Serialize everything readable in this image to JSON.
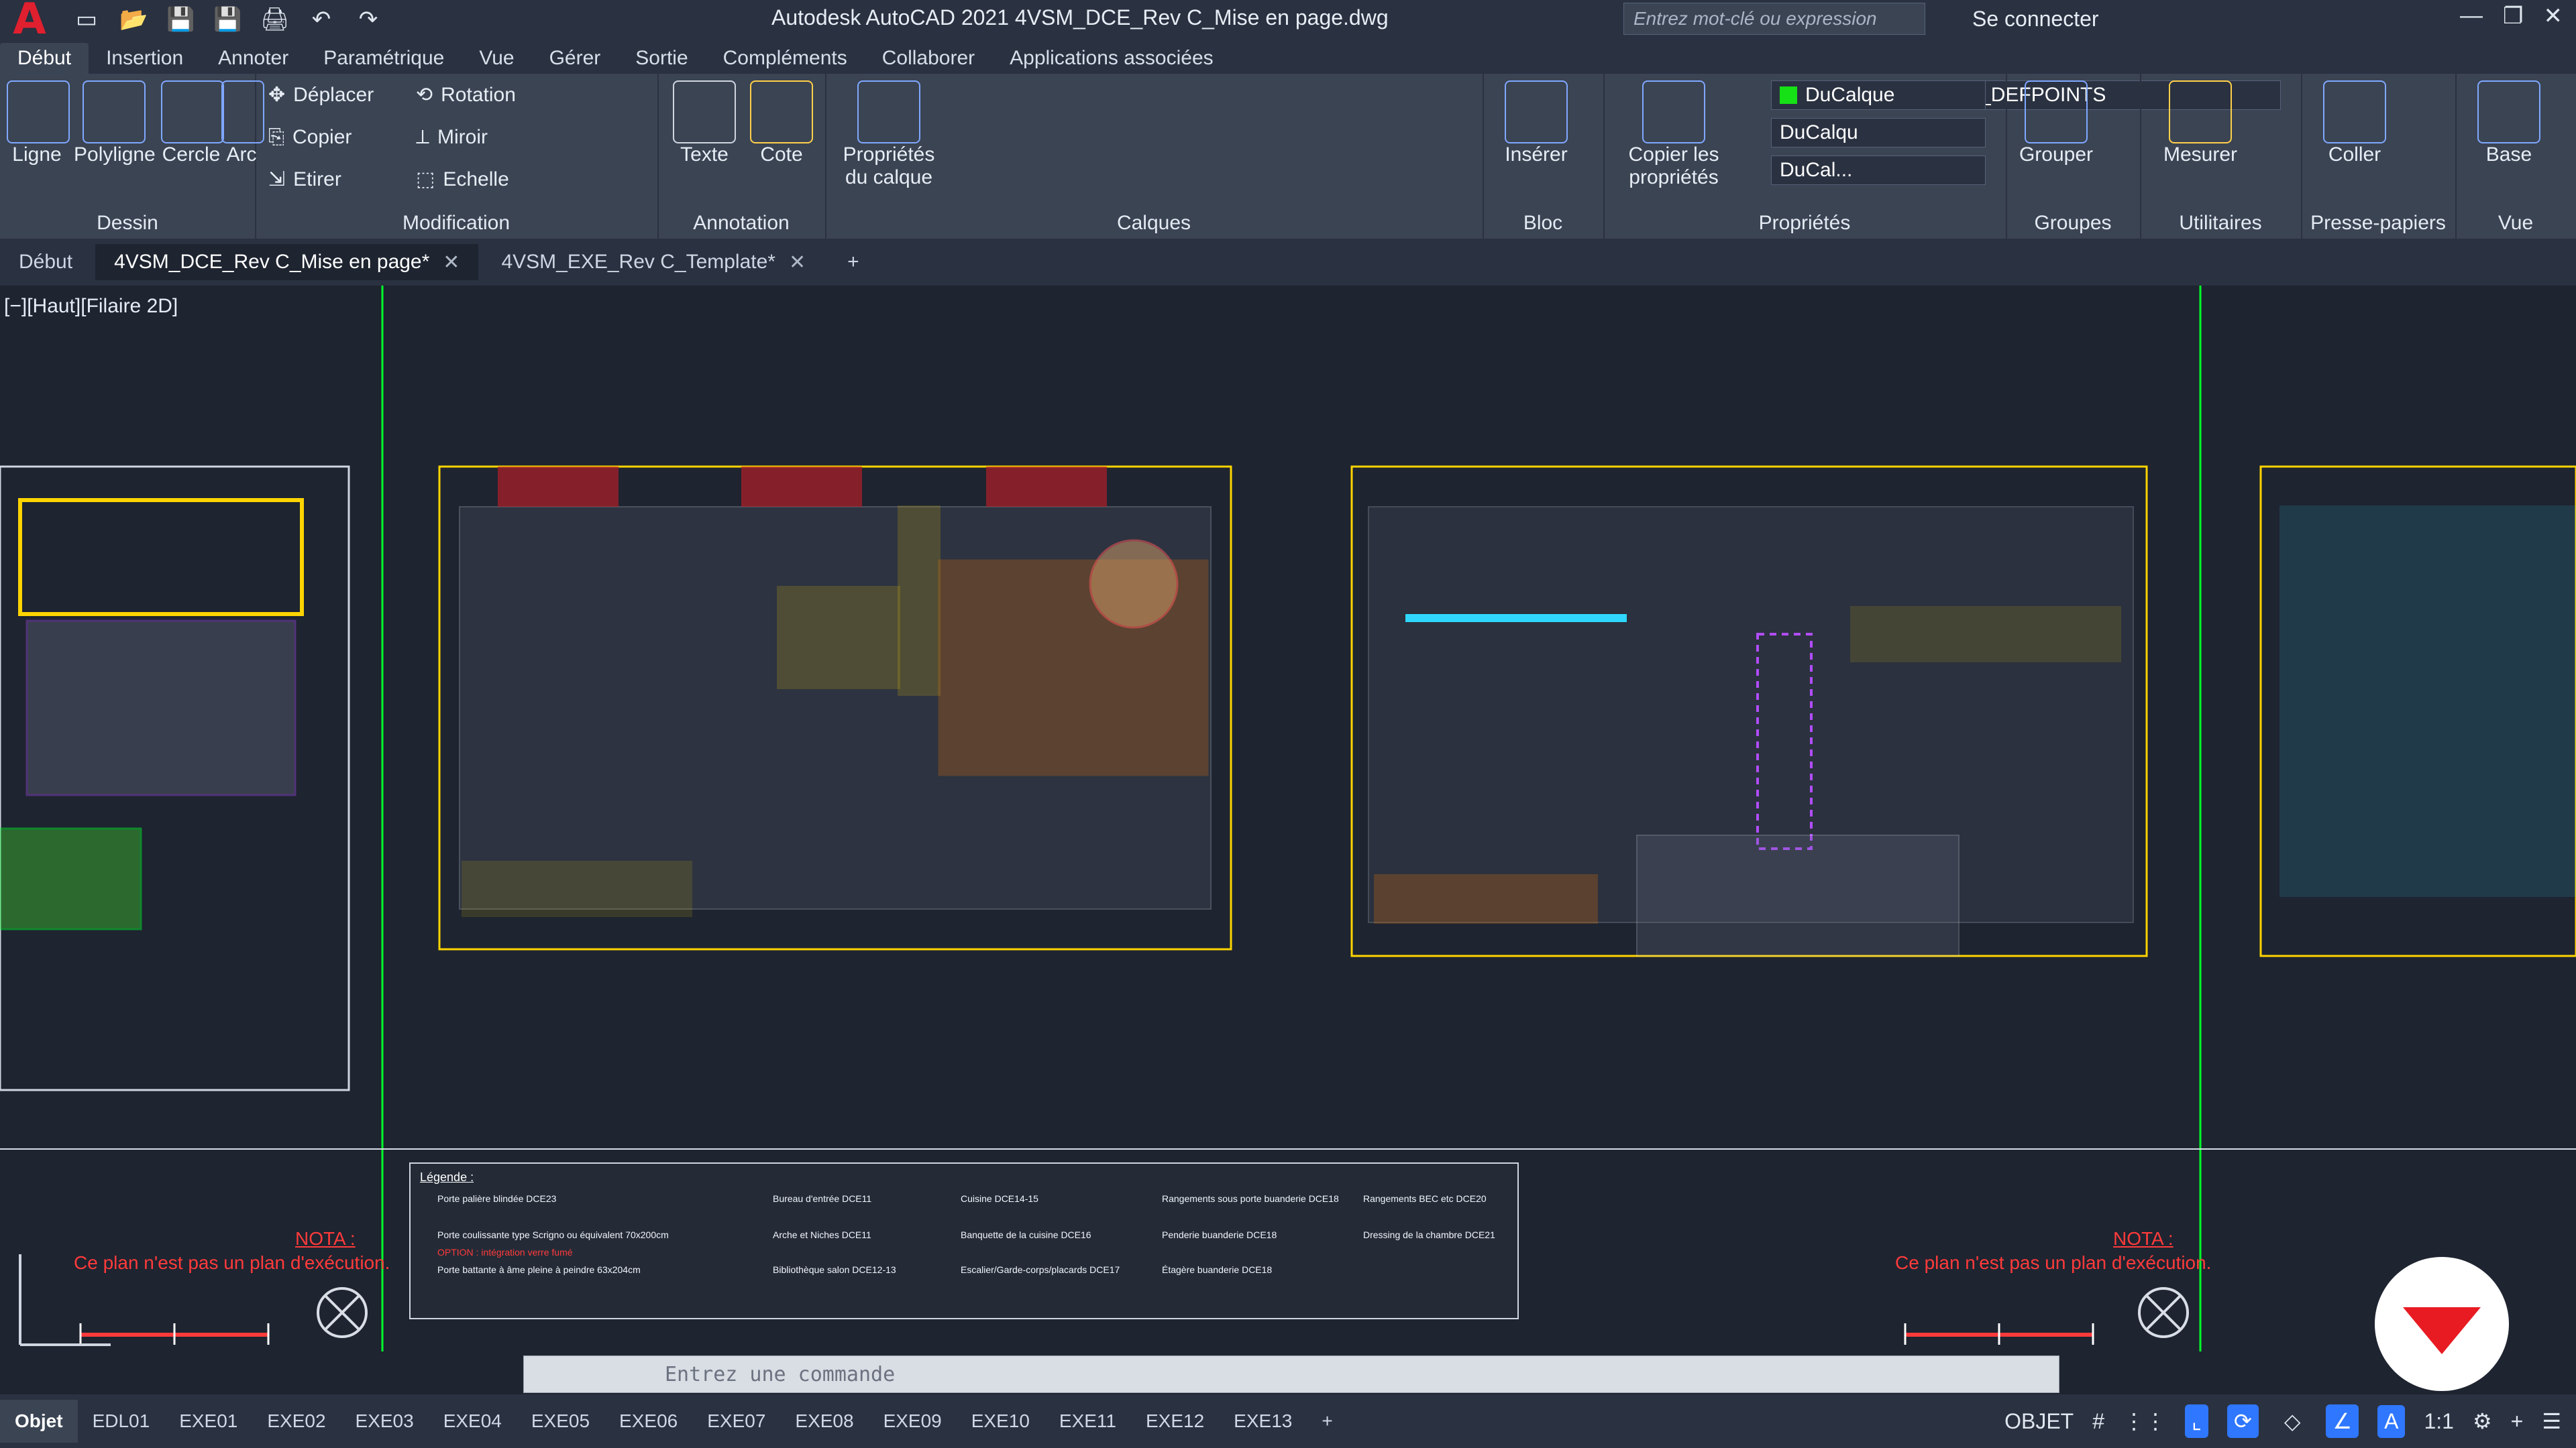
{
  "app": {
    "title": "Autodesk AutoCAD 2021   4VSM_DCE_Rev C_Mise en page.dwg",
    "search_placeholder": "Entrez mot-clé ou expression",
    "signin": "Se connecter"
  },
  "ribbon_tabs": [
    {
      "label": "Début",
      "active": true
    },
    {
      "label": "Insertion"
    },
    {
      "label": "Annoter"
    },
    {
      "label": "Paramétrique"
    },
    {
      "label": "Vue"
    },
    {
      "label": "Gérer"
    },
    {
      "label": "Sortie"
    },
    {
      "label": "Compléments"
    },
    {
      "label": "Collaborer"
    },
    {
      "label": "Applications associées"
    }
  ],
  "ribbon": {
    "dessin": {
      "title": "Dessin",
      "tools": [
        "Ligne",
        "Polyligne",
        "Cercle",
        "Arc"
      ]
    },
    "modification": {
      "title": "Modification",
      "tools": [
        "Déplacer",
        "Rotation",
        "Copier",
        "Miroir",
        "Etirer",
        "Echelle"
      ]
    },
    "annotation": {
      "title": "Annotation",
      "tools": [
        "Texte",
        "Cote"
      ]
    },
    "calques": {
      "title": "Calques",
      "props_label": "Propriétés du calque",
      "layer_name": "A_DEFPOINTS"
    },
    "bloc": {
      "title": "Bloc",
      "insert_label": "Insérer"
    },
    "proprietes": {
      "title": "Propriétés",
      "copy_label": "Copier les propriétés",
      "color": "DuCalque",
      "linetype": "DuCalqu",
      "lineweight": "DuCal..."
    },
    "groupes": {
      "title": "Groupes",
      "group_label": "Grouper"
    },
    "utilitaires": {
      "title": "Utilitaires",
      "measure_label": "Mesurer"
    },
    "presse": {
      "title": "Presse-papiers",
      "paste_label": "Coller"
    },
    "vue": {
      "title": "Vue",
      "base_label": "Base"
    }
  },
  "doc_tabs": [
    {
      "label": "Début",
      "active": false
    },
    {
      "label": "4VSM_DCE_Rev C_Mise en page*",
      "active": true
    },
    {
      "label": "4VSM_EXE_Rev C_Template*",
      "active": false
    }
  ],
  "viewport": {
    "label": "[−][Haut][Filaire 2D]"
  },
  "notes": {
    "left_title": "NOTA :",
    "left_text": "Ce plan n'est pas un plan d'exécution.",
    "right_title": "NOTA :",
    "right_text": "Ce plan n'est pas un plan d'exécution."
  },
  "legend": {
    "title": "Légende :",
    "items": [
      "Porte palière blindée DCE23",
      "Porte coulissante type Scrigno ou équivalent 70x200cm",
      "OPTION : intégration verre fumé",
      "Porte battante à âme pleine à peindre 63x204cm",
      "Bureau d'entrée DCE11",
      "Arche et Niches DCE11",
      "Bibliothèque salon DCE12-13",
      "Cuisine DCE14-15",
      "Banquette de la cuisine DCE16",
      "Escalier/Garde-corps/placards DCE17",
      "Rangements sous porte buanderie DCE18",
      "Penderie buanderie DCE18",
      "Étagère buanderie DCE18",
      "Rangements BEC etc DCE20",
      "Dressing de la chambre DCE21"
    ]
  },
  "cmdline": {
    "placeholder": "Entrez une commande"
  },
  "layout_tabs": [
    "Objet",
    "EDL01",
    "EXE01",
    "EXE02",
    "EXE03",
    "EXE04",
    "EXE05",
    "EXE06",
    "EXE07",
    "EXE08",
    "EXE09",
    "EXE10",
    "EXE11",
    "EXE12",
    "EXE13"
  ],
  "status": {
    "mode": "OBJET",
    "scale": "1:1"
  },
  "colors": {
    "accent": "#2f77ff",
    "brand": "#e81b23"
  }
}
